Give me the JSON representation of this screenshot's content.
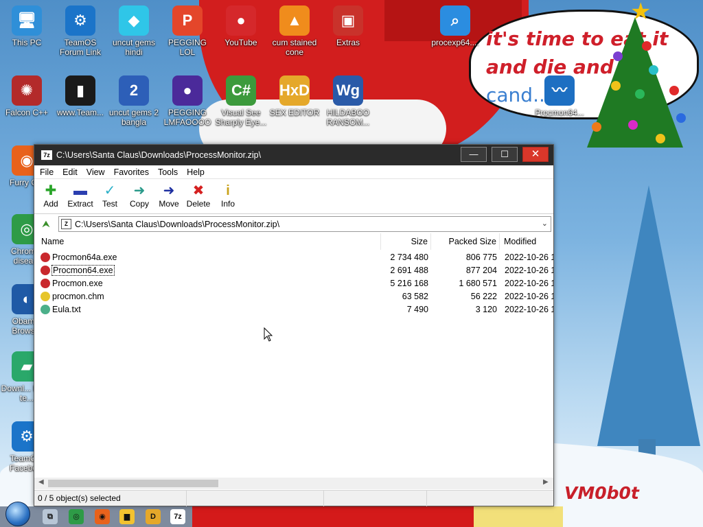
{
  "desktop": {
    "icons": [
      {
        "label": "This PC",
        "icon": "computer-icon",
        "color": "#2f8fd8",
        "glyph": "🖥"
      },
      {
        "label": "TeamOS Forum Link",
        "icon": "gear-icon",
        "color": "#1b74c9",
        "glyph": "⚙"
      },
      {
        "label": "uncut gems hindi",
        "icon": "diamond-icon",
        "color": "#2fc6e8",
        "glyph": "◆"
      },
      {
        "label": "PEGGING LOL",
        "icon": "p-logo-icon",
        "color": "#e4462a",
        "glyph": "P"
      },
      {
        "label": "YouTube",
        "icon": "angry-bird-icon",
        "color": "#d5282b",
        "glyph": "●"
      },
      {
        "label": "cum stained cone",
        "icon": "traffic-cone-icon",
        "color": "#f08c1c",
        "glyph": "▲"
      },
      {
        "label": "Extras",
        "icon": "folder-icon",
        "color": "#c9322b",
        "glyph": "▣"
      },
      {
        "label": "procexp64....",
        "icon": "magnifier-icon",
        "color": "#2b8de0",
        "glyph": "⌕"
      },
      {
        "label": "Falcon C++",
        "icon": "falcon-icon",
        "color": "#b32a2a",
        "glyph": "✺"
      },
      {
        "label": "www.Team...",
        "icon": "book-icon",
        "color": "#1a1a1a",
        "glyph": "▮"
      },
      {
        "label": "uncut gems 2 bangla",
        "icon": "number-two-icon",
        "color": "#2d5fb8",
        "glyph": "2"
      },
      {
        "label": "PEGGING LMFAOOOO",
        "icon": "orb-icon",
        "color": "#4b2a9a",
        "glyph": "●"
      },
      {
        "label": "Visual See Sharply Eye...",
        "icon": "csharp-icon",
        "color": "#3c9a3c",
        "glyph": "C#"
      },
      {
        "label": "SEX EDITOR",
        "icon": "hxd-icon",
        "color": "#e5a82a",
        "glyph": "HxD"
      },
      {
        "label": "HILDABOO RANSOM...",
        "icon": "script-icon",
        "color": "#2a5aa8",
        "glyph": "Wg"
      },
      {
        "label": "Procmon64...",
        "icon": "procmon-icon",
        "color": "#1d6fc2",
        "glyph": "〰"
      },
      {
        "label": "Furry C...",
        "icon": "firefox-icon",
        "color": "#e8621c",
        "glyph": "◉"
      },
      {
        "label": "Chrom... disea...",
        "icon": "chrome-icon",
        "color": "#2e9b47",
        "glyph": "◎"
      },
      {
        "label": "Obam... Brows...",
        "icon": "obama-logo-icon",
        "color": "#1f5aa6",
        "glyph": "◐"
      },
      {
        "label": "Downl... From te...",
        "icon": "download-icon",
        "color": "#2aa86a",
        "glyph": "▰"
      },
      {
        "label": "TeamO... Facebo...",
        "icon": "gear-icon",
        "color": "#1b74c9",
        "glyph": "⚙"
      }
    ],
    "speech_bubble": {
      "line1": "it's time to eat it",
      "line2": "and die and c...",
      "line3": "cand...an"
    },
    "watermark": "VM0b0t"
  },
  "window": {
    "app_icon_text": "7z",
    "title": "C:\\Users\\Santa Claus\\Downloads\\ProcessMonitor.zip\\",
    "controls": {
      "minimize": "—",
      "maximize": "☐",
      "close": "✕"
    },
    "menu": [
      "File",
      "Edit",
      "View",
      "Favorites",
      "Tools",
      "Help"
    ],
    "toolbar": [
      {
        "label": "Add",
        "icon": "plus-icon",
        "glyph": "✚",
        "color": "#2aa52a"
      },
      {
        "label": "Extract",
        "icon": "minus-icon",
        "glyph": "▬",
        "color": "#2b3fb0"
      },
      {
        "label": "Test",
        "icon": "check-icon",
        "glyph": "✓",
        "color": "#2bb0c8"
      },
      {
        "label": "Copy",
        "icon": "copy-arrow-icon",
        "glyph": "➜",
        "color": "#2a9a8a"
      },
      {
        "label": "Move",
        "icon": "move-arrow-icon",
        "glyph": "➜",
        "color": "#1d2fa0"
      },
      {
        "label": "Delete",
        "icon": "delete-x-icon",
        "glyph": "✖",
        "color": "#d52020"
      },
      {
        "label": "Info",
        "icon": "info-icon",
        "glyph": "i",
        "color": "#c9a21a"
      }
    ],
    "address": "C:\\Users\\Santa Claus\\Downloads\\ProcessMonitor.zip\\",
    "columns": {
      "name": "Name",
      "size": "Size",
      "packed": "Packed Size",
      "modified": "Modified"
    },
    "files": [
      {
        "name": "Procmon64a.exe",
        "size": "2 734 480",
        "packed": "806 775",
        "modified": "2022-10-26 1",
        "icon": "exe-icon",
        "color": "#c9282d"
      },
      {
        "name": "Procmon64.exe",
        "size": "2 691 488",
        "packed": "877 204",
        "modified": "2022-10-26 1",
        "icon": "exe-icon",
        "color": "#c9282d"
      },
      {
        "name": "Procmon.exe",
        "size": "5 216 168",
        "packed": "1 680 571",
        "modified": "2022-10-26 1",
        "icon": "exe-icon",
        "color": "#c9282d"
      },
      {
        "name": "procmon.chm",
        "size": "63 582",
        "packed": "56 222",
        "modified": "2022-10-26 1",
        "icon": "help-file-icon",
        "color": "#e6c52a"
      },
      {
        "name": "Eula.txt",
        "size": "7 490",
        "packed": "3 120",
        "modified": "2022-10-26 1",
        "icon": "text-file-icon",
        "color": "#4cb08a"
      }
    ],
    "focused_row": 1,
    "status": "0 / 5 object(s) selected"
  },
  "taskbar": {
    "items": [
      {
        "icon": "task-view-icon",
        "color": "#b8c6d6",
        "glyph": "⧉"
      },
      {
        "icon": "chrome-icon",
        "color": "#2e9b47",
        "glyph": "◎"
      },
      {
        "icon": "firefox-icon",
        "color": "#e8621c",
        "glyph": "◉"
      },
      {
        "icon": "file-explorer-icon",
        "color": "#f2c230",
        "glyph": "▆"
      },
      {
        "icon": "hxd-icon",
        "color": "#e5a82a",
        "glyph": "D"
      },
      {
        "icon": "7zip-icon",
        "color": "#ffffff",
        "glyph": "7z"
      }
    ]
  }
}
